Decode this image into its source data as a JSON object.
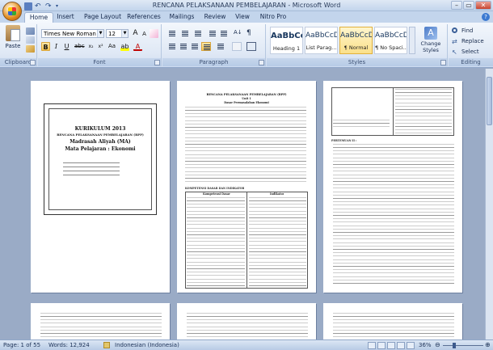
{
  "window": {
    "title": "RENCANA PELAKSANAAN PEMBELAJARAN - Microsoft Word"
  },
  "tabs": [
    {
      "label": "Home",
      "active": true
    },
    {
      "label": "Insert"
    },
    {
      "label": "Page Layout"
    },
    {
      "label": "References"
    },
    {
      "label": "Mailings"
    },
    {
      "label": "Review"
    },
    {
      "label": "View"
    },
    {
      "label": "Nitro Pro"
    }
  ],
  "ribbon": {
    "clipboard": {
      "label": "Clipboard",
      "paste": "Paste"
    },
    "font": {
      "label": "Font",
      "family": "Times New Roman",
      "size": "12"
    },
    "paragraph": {
      "label": "Paragraph"
    },
    "styles": {
      "label": "Styles",
      "tiles": [
        {
          "sample": "AaBbCc",
          "name": "Heading 1"
        },
        {
          "sample": "AaBbCcDd",
          "name": "List Parag..."
        },
        {
          "sample": "AaBbCcDc",
          "name": "¶ Normal",
          "selected": true
        },
        {
          "sample": "AaBbCcDc",
          "name": "¶ No Spaci..."
        }
      ],
      "change": "Change Styles"
    },
    "editing": {
      "label": "Editing",
      "find": "Find",
      "replace": "Replace",
      "select": "Select"
    }
  },
  "pages": {
    "p1": {
      "title": "KURIKULUM 2013",
      "subtitle": "RENCANA PELAKSANAAN PEMBELAJARAN (RPP)",
      "school": "Madrasah Aliyah (MA)",
      "subject": "Mata Pelajaran : Ekonomi"
    },
    "p2": {
      "header": "RENCANA PELAKSANAAN PEMBELAJARAN (RPP)",
      "unit": "Unit 1",
      "topic": "Dasar Permasalahan Ekonomi",
      "section": "KOMPETENSI DASAR DAN INDIKATOR",
      "col1": "Kompetensi Dasar",
      "col2": "Indikator"
    },
    "p3": {
      "heading": "PERTEMUAN II :"
    }
  },
  "status": {
    "page": "Page: 1 of 55",
    "words": "Words: 12,924",
    "language": "Indonesian (Indonesia)",
    "zoom": "36%"
  }
}
